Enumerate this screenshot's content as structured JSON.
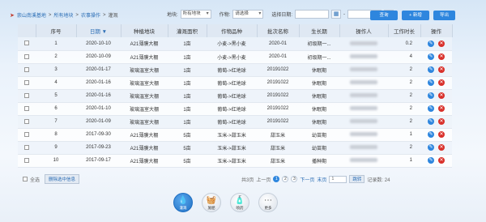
{
  "breadcrumb": {
    "items": [
      "崇山南溪基地",
      "所有地块",
      "农事操作",
      "灌溉"
    ],
    "sep": ">"
  },
  "filters": {
    "plot_label": "地块:",
    "plot_value": "所有地块",
    "crop_label": "作物:",
    "crop_value": "请选择",
    "date_label": "选择日期:",
    "date_sep": "-"
  },
  "buttons": {
    "query": "查询",
    "new": "+ 新增",
    "export": "导出"
  },
  "table": {
    "headers": [
      "",
      "序号",
      "日期 ▼",
      "种植地块",
      "灌溉面积",
      "作物品种",
      "批次名称",
      "生长期",
      "操作人",
      "工作时长",
      "操作"
    ],
    "rows": [
      [
        "1",
        "2020-10-10",
        "A21薄膜大棚",
        "1亩",
        "小麦->黑小麦",
        "2020-01",
        "初级期一...",
        "0.2"
      ],
      [
        "2",
        "2020-10-09",
        "A21薄膜大棚",
        "1亩",
        "小麦->黑小麦",
        "2020-01",
        "初级期一...",
        "4"
      ],
      [
        "3",
        "2020-01-17",
        "玻璃温室大棚",
        "1亩",
        "葡萄->红地球",
        "20191022",
        "休眠期",
        "2"
      ],
      [
        "4",
        "2020-01-16",
        "玻璃温室大棚",
        "1亩",
        "葡萄->红地球",
        "20191022",
        "休眠期",
        "2"
      ],
      [
        "5",
        "2020-01-16",
        "玻璃温室大棚",
        "1亩",
        "葡萄->红地球",
        "20191022",
        "休眠期",
        "2"
      ],
      [
        "6",
        "2020-01-10",
        "玻璃温室大棚",
        "1亩",
        "葡萄->红地球",
        "20191022",
        "休眠期",
        "2"
      ],
      [
        "7",
        "2020-01-09",
        "玻璃温室大棚",
        "1亩",
        "葡萄->红地球",
        "20191022",
        "休眠期",
        "2"
      ],
      [
        "8",
        "2017-09-30",
        "A21薄膜大棚",
        "5亩",
        "玉米->甜玉米",
        "甜玉米",
        "幼苗期",
        "1"
      ],
      [
        "9",
        "2017-09-23",
        "A21薄膜大棚",
        "5亩",
        "玉米->甜玉米",
        "甜玉米",
        "幼苗期",
        "2"
      ],
      [
        "10",
        "2017-09-17",
        "A21薄膜大棚",
        "5亩",
        "玉米->甜玉米",
        "甜玉米",
        "播种期",
        "1"
      ]
    ]
  },
  "footer": {
    "select_all": "全选",
    "delete_selected": "删除选中信息",
    "pages_info": "共3页",
    "prev": "上一页",
    "pages": [
      "1",
      "2",
      "3"
    ],
    "next": "下一页",
    "last": "末页",
    "jump_value": "1",
    "jump_btn": "跳转",
    "total": "记录数: 24"
  },
  "dock": [
    {
      "label": "灌溉",
      "icon": "watering-can-icon",
      "active": true
    },
    {
      "label": "施肥",
      "icon": "fertilizer-icon",
      "active": false
    },
    {
      "label": "喷药",
      "icon": "spray-icon",
      "active": false
    },
    {
      "label": "更多",
      "icon": "more-icon",
      "active": false
    }
  ],
  "colors": {
    "primary": "#2e86de",
    "danger": "#d9302a",
    "header_bg": "#dfe8f3"
  }
}
